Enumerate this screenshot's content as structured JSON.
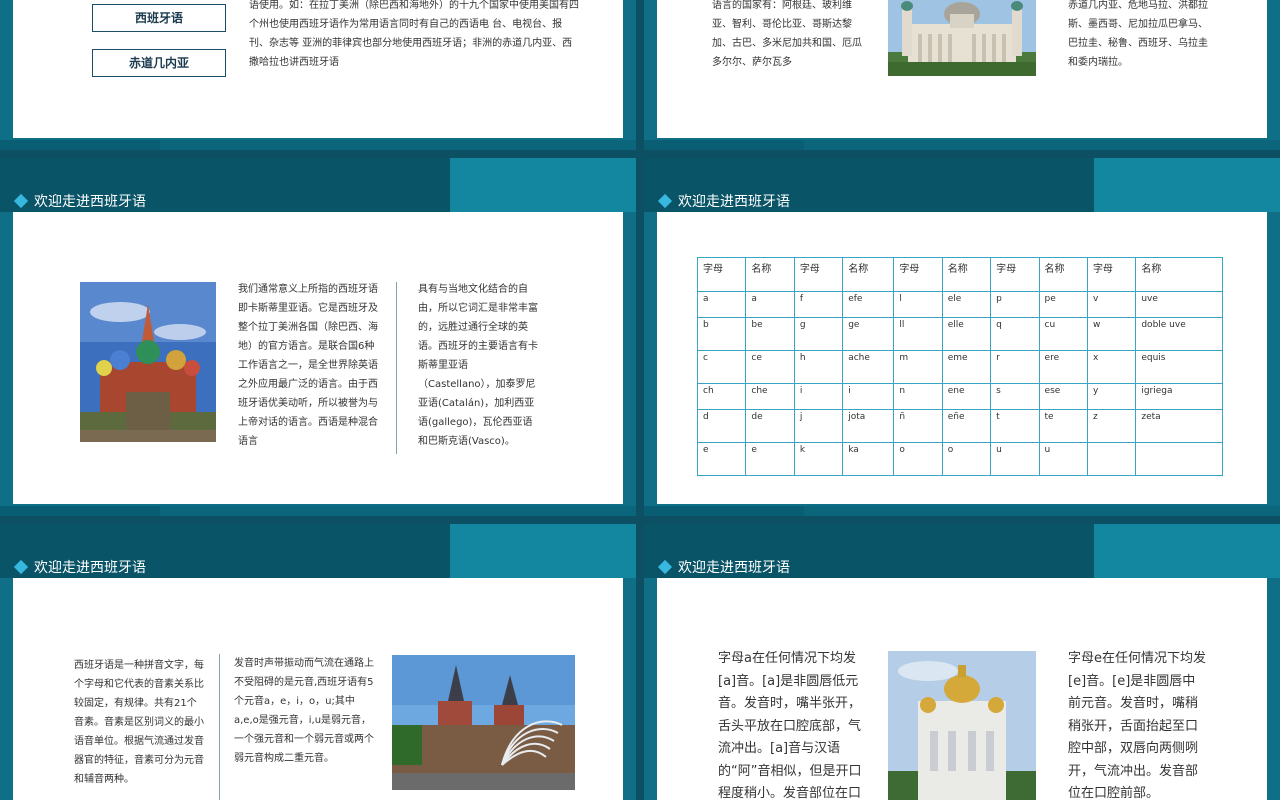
{
  "title": "欢迎走进西班牙语",
  "slide1": {
    "buttons": [
      "西班牙语",
      "赤道几内亚"
    ],
    "text": "语使用。如：在拉丁美洲（除巴西和海地外）的十九个国家中使用美国有四个州也使用西班牙语作为常用语言同时有自己的西语电  台、电视台、报刊、杂志等 亚洲的菲律宾也部分地使用西班牙语；非洲的赤道几内亚、西撒哈拉也讲西班牙语"
  },
  "slide2": {
    "text_left": "语言的国家有：阿根廷、玻利维亚、智利、哥伦比亚、哥斯达黎加、古巴、多米尼加共和国、厄瓜多尔尔、萨尔瓦多",
    "text_right": "赤道几内亚、危地马拉、洪都拉斯、墨西哥、尼加拉瓜巴拿马、巴拉圭、秘鲁、西班牙、乌拉圭和委内瑞拉。"
  },
  "slide3": {
    "text_left": "我们通常意义上所指的西班牙语即卡斯蒂里亚语。它是西班牙及整个拉丁美洲各国（除巴西、海地）的官方语言。是联合国6种工作语言之一，是全世界除英语之外应用最广泛的语言。由于西班牙语优美动听，所以被誉为与上帝对话的语言。西语是种混合语言",
    "text_right": "具有与当地文化结合的自由，所以它词汇是非常丰富的，远胜过通行全球的英语。西班牙的主要语言有卡斯蒂里亚语（Castellano），加泰罗尼亚语(Catalán)，加利西亚语(gallego)，瓦伦西亚语和巴斯克语(Vasco)。"
  },
  "slide4": {
    "headers": [
      "字母",
      "名称",
      "字母",
      "名称",
      "字母",
      "名称",
      "字母",
      "名称",
      "字母",
      "名称"
    ],
    "rows": [
      [
        "a",
        "a",
        "f",
        "efe",
        "l",
        "ele",
        "p",
        "pe",
        "v",
        "uve"
      ],
      [
        "b",
        "be",
        "g",
        "ge",
        "ll",
        "elle",
        "q",
        "cu",
        "w",
        "doble uve"
      ],
      [
        "c",
        "ce",
        "h",
        "ache",
        "m",
        "eme",
        "r",
        "ere",
        "x",
        "equis"
      ],
      [
        "ch",
        "che",
        "i",
        "i",
        "n",
        "ene",
        "s",
        "ese",
        "y",
        "igriega"
      ],
      [
        "d",
        "de",
        "j",
        "jota",
        "ñ",
        "eñe",
        "t",
        "te",
        "z",
        "zeta"
      ],
      [
        "e",
        "e",
        "k",
        "ka",
        "o",
        "o",
        "u",
        "u",
        "",
        ""
      ]
    ]
  },
  "slide5": {
    "text_left": "西班牙语是一种拼音文字，每个字母和它代表的音素关系比较固定，有规律。共有21个音素。音素是区别词义的最小语音单位。根据气流通过发音器官的特征，音素可分为元音和辅音两种。",
    "text_mid": "发音时声带振动而气流在通路上不受阻碍的是元音,西班牙语有5个元音a，e，i，o，u;其中a,e,o是强元音，i,u是弱元音，一个强元音和一个弱元音或两个弱元音构成二重元音。"
  },
  "slide6": {
    "text_left": "字母a在任何情况下均发[a]音。[a]是非圆唇低元音。发音时，嘴半张开，舌头平放在口腔底部，气流冲出。[a]音与汉语的“阿”音相似，但是开口程度稍小。发音部位在口腔中部。",
    "text_right": "字母e在任何情况下均发[e]音。[e]是非圆唇中前元音。发音时，嘴稍稍张开，舌面抬起至口腔中部，双唇向两侧咧开，气流冲出。发音部位在口腔前部。"
  }
}
